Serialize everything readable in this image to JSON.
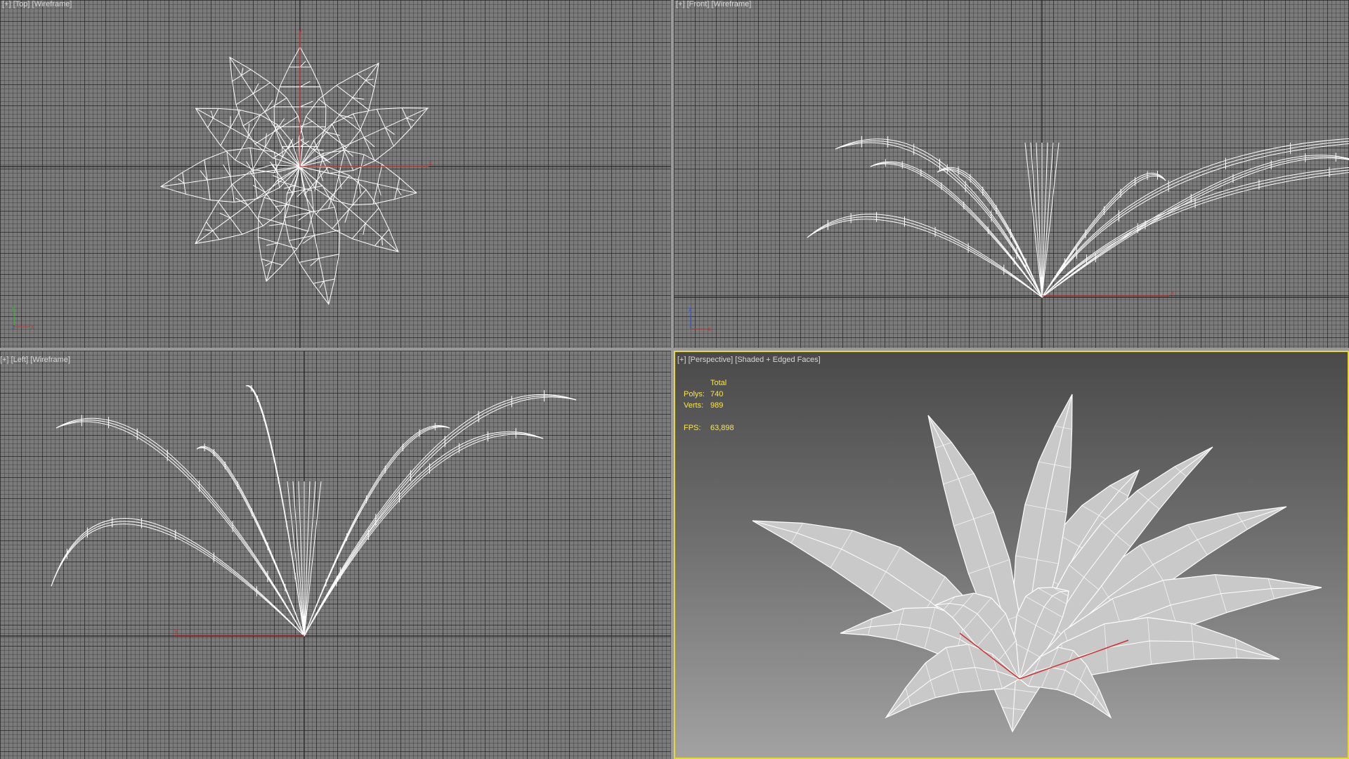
{
  "viewports": {
    "top": {
      "label_plus": "[+]",
      "label_view": "[Top]",
      "label_mode": "[Wireframe]"
    },
    "front": {
      "label_plus": "[+]",
      "label_view": "[Front]",
      "label_mode": "[Wireframe]"
    },
    "left": {
      "label_plus": "[+]",
      "label_view": "[Left]",
      "label_mode": "[Wireframe]"
    },
    "perspective": {
      "label_plus": "[+]",
      "label_view": "[Perspective]",
      "label_mode": "[Shaded + Edged Faces]"
    }
  },
  "stats": {
    "header": "Total",
    "polys_label": "Polys:",
    "polys_value": "740",
    "verts_label": "Verts:",
    "verts_value": "989",
    "fps_label": "FPS:",
    "fps_value": "63,898"
  },
  "axis_labels": {
    "x": "x",
    "y": "y",
    "z": "z"
  },
  "colors": {
    "active_border": "#e8d837",
    "stats_text": "#ffe83a",
    "axis_x": "#d03030",
    "axis_y": "#30c030",
    "axis_z": "#3050e0",
    "wire": "#ffffff"
  },
  "icons": [
    "axis-tripod-icon",
    "pivot-gizmo-icon"
  ]
}
